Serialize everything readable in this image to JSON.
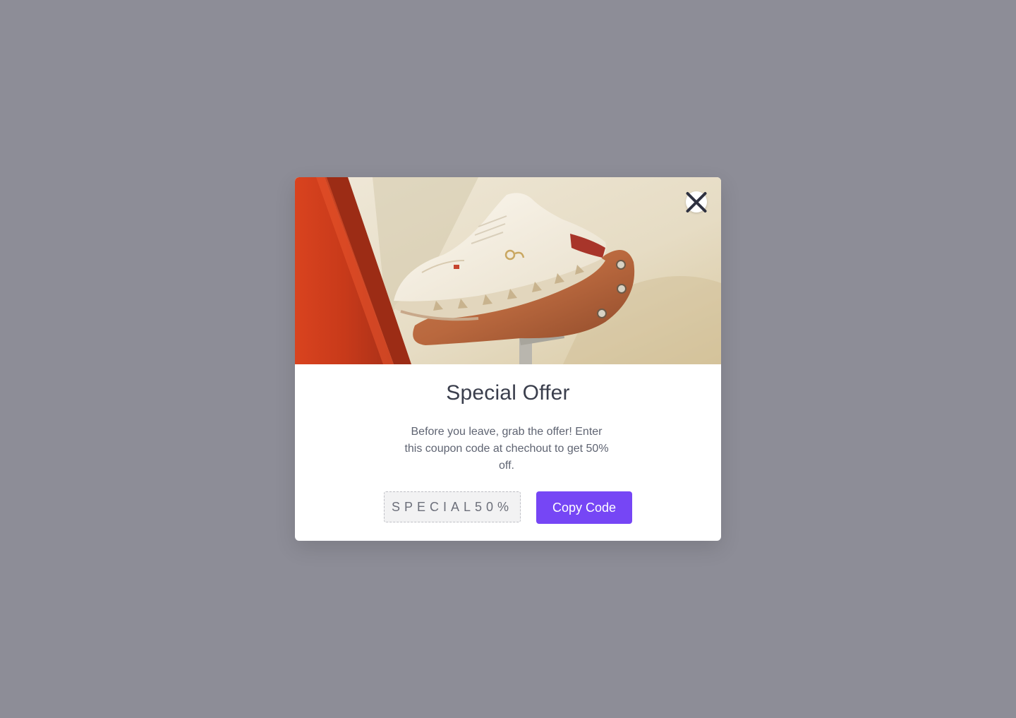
{
  "modal": {
    "image_alt": "shoe-on-bicycle-saddle",
    "close_icon": "close-icon",
    "title": "Special Offer",
    "description": "Before you leave, grab the offer! Enter this coupon code at chechout to get 50% off.",
    "coupon_code": "SPECIAL50%",
    "copy_button_label": "Copy Code"
  },
  "colors": {
    "overlay": "#8d8d97",
    "accent": "#7646f5",
    "title": "#3a3e4c",
    "body_text": "#5f6472"
  }
}
